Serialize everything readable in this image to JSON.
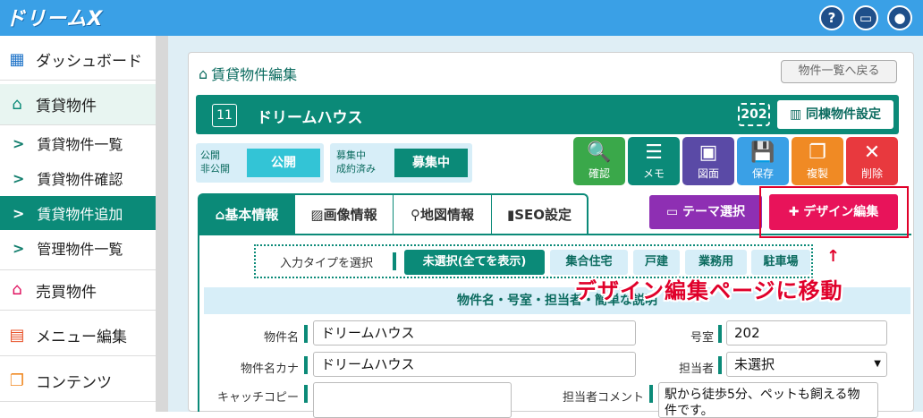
{
  "app": {
    "logo": "ドリームX",
    "icons": [
      "help-icon",
      "card-icon",
      "user-icon"
    ]
  },
  "sidebar": {
    "dashboard": "ダッシュボード",
    "rental": "賃貸物件",
    "rental_list": "賃貸物件一覧",
    "rental_confirm": "賃貸物件確認",
    "rental_add": "賃貸物件追加",
    "managed_list": "管理物件一覧",
    "sale": "売買物件",
    "menu_edit": "メニュー編集",
    "contents": "コンテンツ"
  },
  "header": {
    "title": "賃貸物件編集",
    "back": "物件一覧へ戻る"
  },
  "property": {
    "id": "11",
    "name": "ドリームハウス",
    "room": "202",
    "same_building": "同棟物件設定"
  },
  "status": {
    "publish_label": [
      "公開",
      "非公開"
    ],
    "publish_value": "公開",
    "recruit_label": [
      "募集中",
      "成約済み"
    ],
    "recruit_value": "募集中"
  },
  "actions": {
    "confirm": "確認",
    "memo": "メモ",
    "floorplan": "図面",
    "save": "保存",
    "copy": "複製",
    "delete": "削除"
  },
  "tabs": {
    "basic": "基本情報",
    "image": "画像情報",
    "map": "地図情報",
    "seo": "SEO設定"
  },
  "theme_button": "テーマ選択",
  "design_button": "デザイン編集",
  "annotation": {
    "arrow": "↑",
    "text": "デザイン編集ページに移動"
  },
  "input_type": {
    "label": "入力タイプを選択",
    "options": [
      "未選択(全てを表示)",
      "集合住宅",
      "戸建",
      "業務用",
      "駐車場"
    ]
  },
  "section_title": "物件名・号室・担当者・簡単な説明",
  "form": {
    "name_label": "物件名",
    "name_value": "ドリームハウス",
    "kana_label": "物件名カナ",
    "kana_value": "ドリームハウス",
    "catch_label": "キャッチコピー",
    "catch_value": "",
    "room_label": "号室",
    "room_value": "202",
    "staff_label": "担当者",
    "staff_value": "未選択",
    "comment_label": "担当者コメント",
    "comment_value": "駅から徒歩5分、ペットも飼える物件です。"
  }
}
